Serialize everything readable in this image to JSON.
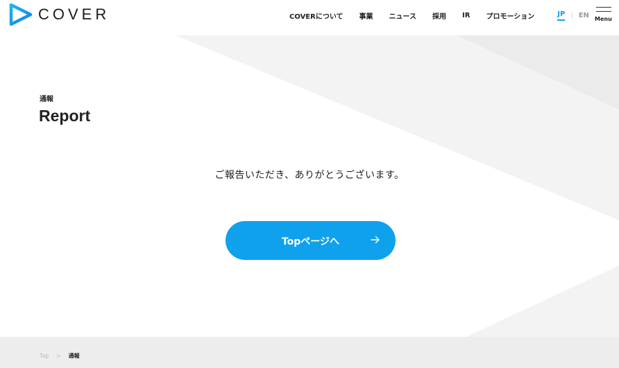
{
  "header": {
    "logo_text": "COVER",
    "nav": [
      {
        "label": "COVERについて"
      },
      {
        "label": "事業"
      },
      {
        "label": "ニュース"
      },
      {
        "label": "採用"
      },
      {
        "label": "IR"
      },
      {
        "label": "プロモーション"
      }
    ],
    "lang": {
      "jp": "JP",
      "separator": "|",
      "en": "EN"
    },
    "menu_label": "Menu"
  },
  "page": {
    "subtitle": "通報",
    "title": "Report",
    "message": "ご報告いただき、ありがとうございます。",
    "button_label": "Topページへ"
  },
  "breadcrumb": {
    "top": "Top",
    "separator": ">",
    "current": "通報"
  },
  "colors": {
    "accent": "#0fa1ec",
    "footer_bg": "#ededed",
    "shape_bg": "#f2f2f2"
  },
  "icons": {
    "logo": "play-triangle-logo-icon",
    "button_arrow": "arrow-right-icon",
    "menu": "hamburger-menu-icon"
  }
}
